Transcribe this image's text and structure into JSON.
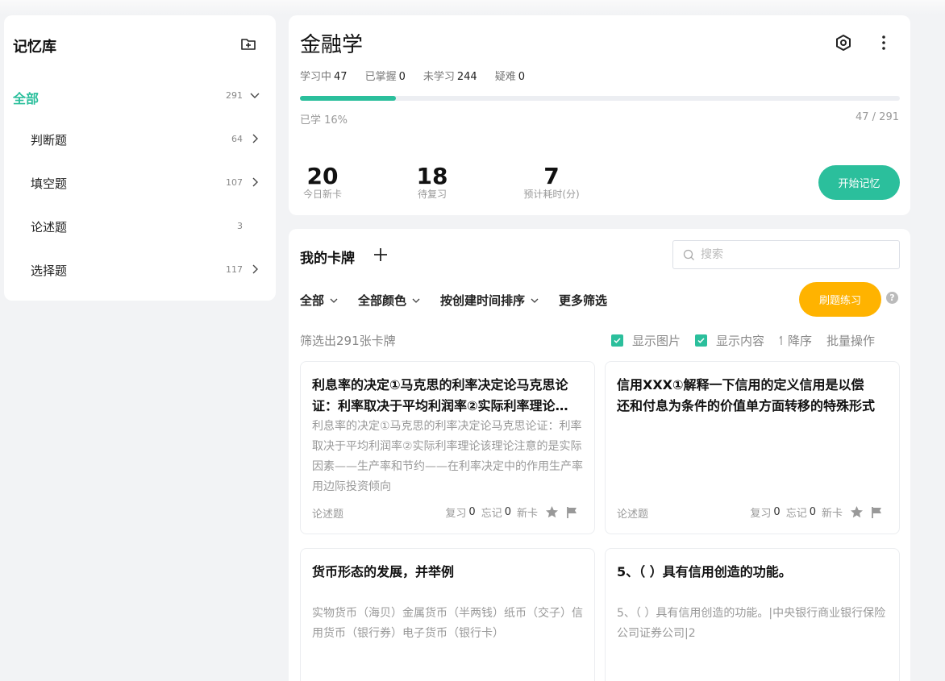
{
  "sidebar": {
    "title": "记忆库",
    "items": [
      {
        "label": "全部",
        "count": "291"
      },
      {
        "label": "判断题",
        "count": "64"
      },
      {
        "label": "填空题",
        "count": "107"
      },
      {
        "label": "论述题",
        "count": "3"
      },
      {
        "label": "选择题",
        "count": "117"
      }
    ]
  },
  "summary": {
    "title": "金融学",
    "stats": [
      {
        "label": "学习中",
        "value": "47"
      },
      {
        "label": "已掌握",
        "value": "0"
      },
      {
        "label": "未学习",
        "value": "244"
      },
      {
        "label": "疑难",
        "value": "0"
      }
    ],
    "progress_percent": 16,
    "progress_label": "已学 16%",
    "progress_count": "47 / 291",
    "metrics": [
      {
        "value": "20",
        "caption": "今日新卡"
      },
      {
        "value": "18",
        "caption": "待复习"
      },
      {
        "value": "7",
        "caption": "预计耗时(分)"
      }
    ],
    "start_button": "开始记忆"
  },
  "cards_panel": {
    "title": "我的卡牌",
    "search_placeholder": "搜索",
    "filters": [
      "全部",
      "全部颜色",
      "按创建时间排序",
      "更多筛选"
    ],
    "practice_button": "刷题练习",
    "help": "?",
    "result_text": "筛选出291张卡牌",
    "options": {
      "show_image": "显示图片",
      "show_content": "显示内容",
      "sort_desc": "降序",
      "batch": "批量操作"
    },
    "cards": [
      {
        "question": "利息率的决定①马克思的利率决定论马克思论证：利率取决于平均利润率②实际利率理论该理论注意的是",
        "answer": "利息率的决定①马克思的利率决定论马克思论证：利率取决于平均利润率②实际利率理论该理论注意的是实际因素——生产率和节约——在利率决定中的作用生产率　　用边际投资倾向",
        "type": "论述题",
        "review_label": "复习",
        "review": "0",
        "forget_label": "忘记",
        "forget": "0",
        "status": "新卡"
      },
      {
        "question": "信用XXX①解释一下信用的定义信用是以偿还和付息为条件的价值单方面转移的特殊形式",
        "answer": "",
        "type": "论述题",
        "review_label": "复习",
        "review": "0",
        "forget_label": "忘记",
        "forget": "0",
        "status": "新卡"
      },
      {
        "question": "货币形态的发展，并举例",
        "answer": "实物货币（海贝）金属货币（半两钱）纸币（交子）信用货币（银行券）电子货币（银行卡）",
        "type": "",
        "review_label": "",
        "review": "",
        "forget_label": "",
        "forget": "",
        "status": ""
      },
      {
        "question": "5、（ ）具有信用创造的功能。",
        "answer": "5、（ ）具有信用创造的功能。|中央银行商业银行保险公司证券公司|2",
        "type": "",
        "review_label": "",
        "review": "",
        "forget_label": "",
        "forget": "",
        "status": ""
      }
    ]
  },
  "colors": {
    "accent": "#2bbf9c",
    "practice": "#ffb300"
  }
}
